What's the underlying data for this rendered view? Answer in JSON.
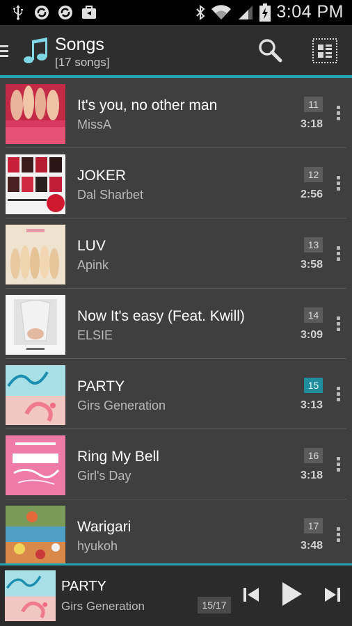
{
  "status_bar": {
    "time": "3:04 PM",
    "icons": [
      "usb-icon",
      "sync-icon",
      "sync-icon",
      "briefcase-icon",
      "bluetooth-icon",
      "wifi-icon",
      "signal-icon",
      "battery-icon"
    ]
  },
  "action_bar": {
    "title": "Songs",
    "subtitle": "[17 songs]",
    "accent": "#25a4b6"
  },
  "songs": [
    {
      "title": "It's you, no other man",
      "artist": "MissA",
      "number": "11",
      "duration": "3:18",
      "active": false
    },
    {
      "title": "JOKER",
      "artist": "Dal Sharbet",
      "number": "12",
      "duration": "2:56",
      "active": false
    },
    {
      "title": "LUV",
      "artist": "Apink",
      "number": "13",
      "duration": "3:58",
      "active": false
    },
    {
      "title": "Now It's easy (Feat. Kwill)",
      "artist": "ELSIE",
      "number": "14",
      "duration": "3:09",
      "active": false
    },
    {
      "title": "PARTY",
      "artist": "Girs Generation",
      "number": "15",
      "duration": "3:13",
      "active": true
    },
    {
      "title": "Ring My Bell",
      "artist": "Girl's Day",
      "number": "16",
      "duration": "3:18",
      "active": false
    },
    {
      "title": "Warigari",
      "artist": "hyukoh",
      "number": "17",
      "duration": "3:48",
      "active": false
    }
  ],
  "now_playing": {
    "title": "PARTY",
    "artist": "Girs Generation",
    "position": "15/17"
  }
}
